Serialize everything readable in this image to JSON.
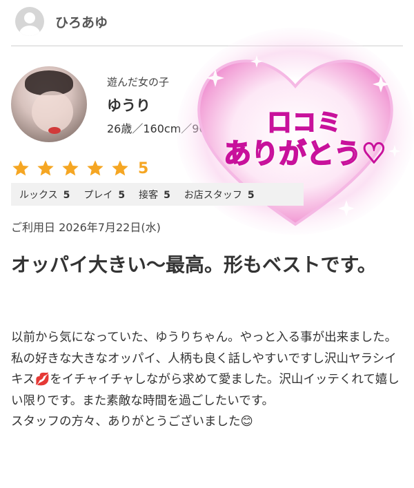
{
  "reviewer": {
    "name": "ひろあゆ"
  },
  "girl": {
    "label": "遊んだ女の子",
    "name": "ゆうり",
    "stats": "26歳／160cm／96(F)-86"
  },
  "rating": {
    "stars": 5,
    "max_stars": 5,
    "score_text": "5",
    "star_color": "#f5a623",
    "categories": [
      {
        "label": "ルックス",
        "value": "5"
      },
      {
        "label": "プレイ",
        "value": "5"
      },
      {
        "label": "接客",
        "value": "5"
      },
      {
        "label": "お店スタッフ",
        "value": "5"
      }
    ]
  },
  "review": {
    "visit_date": "ご利用日 2026年7月22日(水)",
    "title": "オッパイ大きい〜最高。形もベストです。",
    "body": [
      "以前から気になっていた、ゆうりちゃん。やっと入る事が出来ました。私の好きな大きなオッパイ、人柄も良く話しやすいですし沢山ヤラシイキス💋をイチャイチャしながら求めて愛ました。沢山イッテくれて嬉しい限りです。また素敵な時間を過ごしたいです。",
      "スタッフの方々、ありがとうございました😊"
    ]
  },
  "banner": {
    "line1": "口コミ",
    "line2": "ありがとう♡",
    "accent": "#c8119b"
  }
}
